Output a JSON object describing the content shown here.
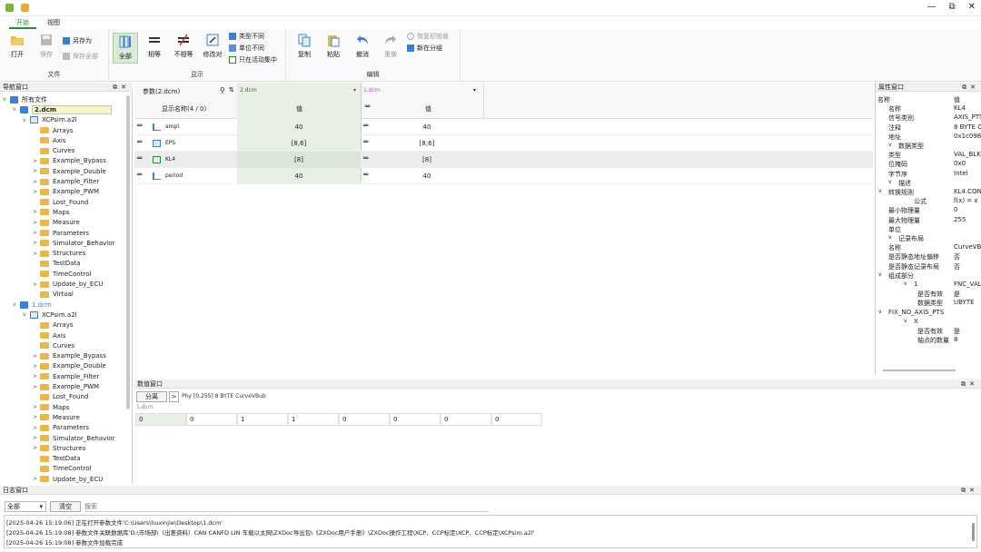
{
  "window": {
    "minimize": "—",
    "restore": "⧉",
    "close": "✕"
  },
  "tabs": [
    "开始",
    "视图"
  ],
  "ribbon": {
    "file": {
      "label": "文件",
      "open": "打开",
      "save": "保存",
      "save_as": "另存为",
      "save_all": "保存全部"
    },
    "display": {
      "label": "显示",
      "all": "全部",
      "equal": "相等",
      "not_equal": "不相等",
      "modify_compare": "修改对",
      "type_diff": "类型不同",
      "unit_diff": "单位不同",
      "only_active": "只在活动集中"
    },
    "edit": {
      "label": "编辑",
      "copy": "复制",
      "paste": "粘贴",
      "undo": "撤消",
      "redo": "重做",
      "restore_init": "恢复初始值",
      "new_group": "新在分组"
    }
  },
  "nav": {
    "title": "导航窗口",
    "root": "所有文件",
    "files": [
      {
        "name": "2.dcm",
        "a2l": "XCPsim.a2l",
        "items": [
          "Arrays",
          "Axis",
          "Curves",
          "Example_Bypass",
          "Example_Double",
          "Example_Filter",
          "Example_PWM",
          "Lost_Found",
          "Maps",
          "Measure",
          "Parameters",
          "Simulator_Behavior",
          "Structures",
          "TestData",
          "TimeControl",
          "Update_by_ECU",
          "Virtual"
        ]
      },
      {
        "name": "1.dcm",
        "a2l": "XCPsim.a2l",
        "items": [
          "Arrays",
          "Axis",
          "Curves",
          "Example_Bypass",
          "Example_Double",
          "Example_Filter",
          "Example_PWM",
          "Lost_Found",
          "Maps",
          "Measure",
          "Parameters",
          "Simulator_Behavior",
          "Structures",
          "TestData",
          "TimeControl",
          "Update_by_ECU"
        ]
      }
    ]
  },
  "grid": {
    "param_header": "参数(2.dcm)",
    "display_name_header": "显示名称(4 / 0)",
    "col2_file": "2.dcm",
    "col1_file": "1.dcm",
    "value_header": "值",
    "rows": [
      {
        "name": "ampl",
        "v2": "40",
        "v1": "40"
      },
      {
        "name": "EPS",
        "v2": "[8,6]",
        "v1": "[8,6]"
      },
      {
        "name": "KL4",
        "v2": "[8]",
        "v1": "[8]"
      },
      {
        "name": "period",
        "v2": "40",
        "v1": "40"
      }
    ]
  },
  "props": {
    "title": "属性窗口",
    "rows": [
      {
        "k": "名称",
        "v": "值",
        "lvl": 0,
        "exp": ""
      },
      {
        "k": "名称",
        "v": "KL4",
        "lvl": 2,
        "exp": ""
      },
      {
        "k": "信号类别",
        "v": "AXIS_PTS",
        "lvl": 2,
        "exp": ""
      },
      {
        "k": "注释",
        "v": "8 BYTE C",
        "lvl": 2,
        "exp": ""
      },
      {
        "k": "地址",
        "v": "0x1c098c",
        "lvl": 2,
        "exp": ""
      },
      {
        "k": "数据类型",
        "v": "",
        "lvl": 1,
        "exp": "v"
      },
      {
        "k": "类型",
        "v": "VAL_BLK",
        "lvl": 2,
        "exp": ""
      },
      {
        "k": "位掩码",
        "v": "0x0",
        "lvl": 2,
        "exp": ""
      },
      {
        "k": "字节序",
        "v": "Intel",
        "lvl": 2,
        "exp": ""
      },
      {
        "k": "描述",
        "v": "",
        "lvl": 1,
        "exp": "v"
      },
      {
        "k": "转换规则",
        "v": "KL4.CON",
        "lvl": 2,
        "exp": "v"
      },
      {
        "k": "公式",
        "v": "f(x) = x",
        "lvl": 3,
        "exp": ""
      },
      {
        "k": "最小物理量",
        "v": "0",
        "lvl": 2,
        "exp": ""
      },
      {
        "k": "最大物理量",
        "v": "255",
        "lvl": 2,
        "exp": ""
      },
      {
        "k": "单位",
        "v": "",
        "lvl": 2,
        "exp": ""
      },
      {
        "k": "记录布局",
        "v": "",
        "lvl": 1,
        "exp": "v"
      },
      {
        "k": "名称",
        "v": "CurveVBu",
        "lvl": 2,
        "exp": ""
      },
      {
        "k": "是否静态地址偏移",
        "v": "否",
        "lvl": 2,
        "exp": ""
      },
      {
        "k": "是否静态记录布局",
        "v": "否",
        "lvl": 2,
        "exp": ""
      },
      {
        "k": "组成部分",
        "v": "",
        "lvl": 2,
        "exp": "v"
      },
      {
        "k": "1",
        "v": "FNC_VAL",
        "lvl": 3,
        "exp": "v"
      },
      {
        "k": "是否有效",
        "v": "是",
        "lvl": 4,
        "exp": ""
      },
      {
        "k": "数据类型",
        "v": "UBYTE",
        "lvl": 4,
        "exp": ""
      },
      {
        "k": "FIX_NO_AXIS_PTS",
        "v": "",
        "lvl": 2,
        "exp": "v"
      },
      {
        "k": "X",
        "v": "",
        "lvl": 3,
        "exp": "v"
      },
      {
        "k": "是否有效",
        "v": "是",
        "lvl": 4,
        "exp": ""
      },
      {
        "k": "轴点的数量",
        "v": "8",
        "lvl": 4,
        "exp": ""
      }
    ]
  },
  "value_window": {
    "title": "数值窗口",
    "split_label": "分离",
    "arrow": ">",
    "info": "Phy [0,255]   8 BYTE CurveVBub",
    "file": "1.dcm",
    "values": [
      "0",
      "0",
      "1",
      "1",
      "0",
      "0",
      "0",
      "0"
    ]
  },
  "log": {
    "title": "日志窗口",
    "filter": "全部",
    "clear": "清空",
    "search_placeholder": "搜索",
    "lines": [
      "[2025-04-26 15:19:06] 正在打开参数文件'C:\\Users\\huxinjie\\Desktop\\1.dcm'",
      "[2025-04-26 15:19:08] 参数文件关联数据库'D:\\市场部\\（出差资料）CAN CANFD LIN 车载以太网\\ZXDoc导出包\\《ZXDoc用户手册》\\ZXDoc操作工程\\XCP、CCP标定\\XCP、CCP标定\\XCPsim.a2l'",
      "[2025-04-26 15:19:08] 参数文件加载完成"
    ]
  }
}
